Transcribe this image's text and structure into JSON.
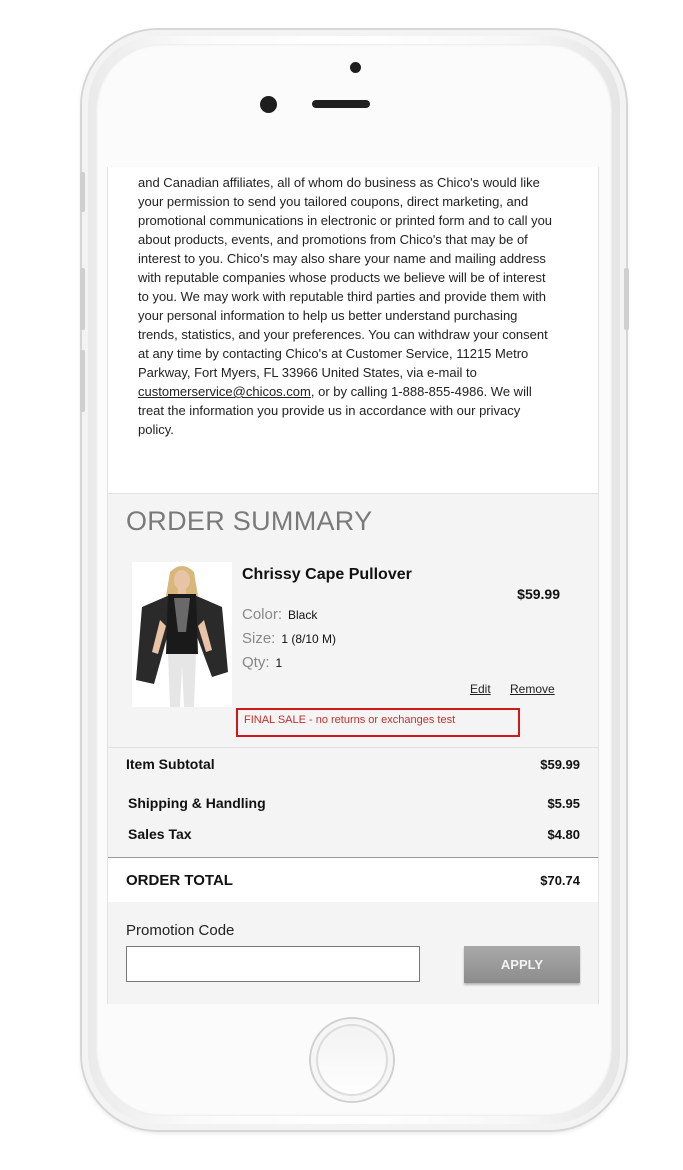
{
  "legal": {
    "text_before_link": "and Canadian affiliates, all of whom do business as Chico's would like your permission to send you tailored coupons, direct marketing, and promotional communications in electronic or printed form and to call you about products, events, and promotions from Chico's that may be of interest to you. Chico's may also share your name and mailing address with reputable companies whose products we believe will be of interest to you. We may work with reputable third parties and provide them with your personal information to help us better understand purchasing trends, statistics, and your preferences. You can withdraw your consent at any time by contacting Chico's at Customer Service, 11215 Metro Parkway, Fort Myers, FL 33966 United States, via e-mail to ",
    "email_link": "customerservice@chicos.com",
    "text_after_link": ", or by calling 1-888-855-4986. We will treat the information you provide us in accordance with our privacy policy."
  },
  "order_summary": {
    "title": "ORDER SUMMARY",
    "item": {
      "name": "Chrissy Cape Pullover",
      "price": "$59.99",
      "color_label": "Color:",
      "color_value": "Black",
      "size_label": "Size:",
      "size_value": "1 (8/10 M)",
      "qty_label": "Qty:",
      "qty_value": "1",
      "edit_label": "Edit",
      "remove_label": "Remove",
      "final_sale_note": "FINAL SALE - no returns or exchanges test"
    }
  },
  "totals": {
    "item_subtotal_label": "Item Subtotal",
    "item_subtotal_value": "$59.99",
    "shipping_label": "Shipping & Handling",
    "shipping_value": "$5.95",
    "tax_label": "Sales Tax",
    "tax_value": "$4.80",
    "order_total_label": "ORDER TOTAL",
    "order_total_value": "$70.74"
  },
  "promo": {
    "label": "Promotion Code",
    "input_value": "",
    "apply_label": "APPLY"
  },
  "colors": {
    "final_sale_border": "#d11818",
    "final_sale_text": "#c2302e",
    "summary_bg": "#f4f4f4"
  }
}
